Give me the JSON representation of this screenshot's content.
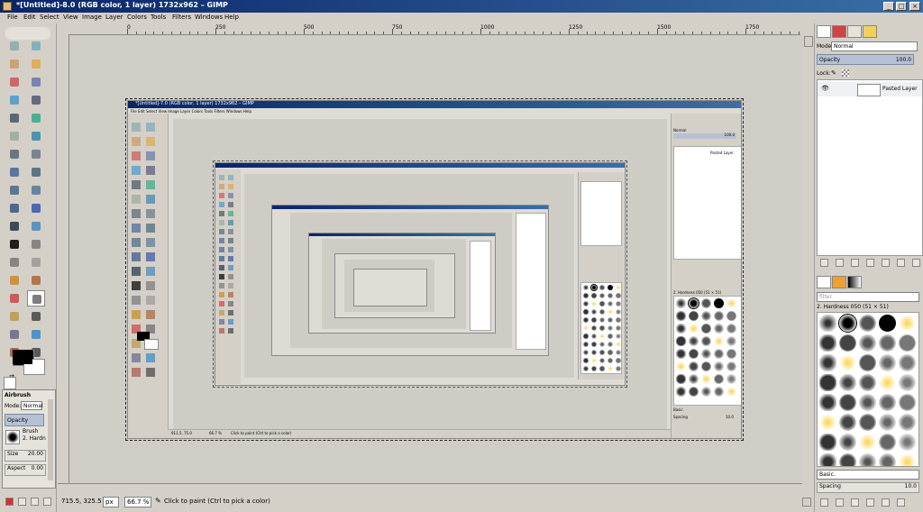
{
  "window": {
    "title": "*[Untitled]-8.0 (RGB color, 1 layer) 1732x962 – GIMP",
    "controls": [
      "_",
      "□",
      "×"
    ]
  },
  "menu": [
    "File",
    "Edit",
    "Select",
    "View",
    "Image",
    "Layer",
    "Colors",
    "Tools",
    "Filters",
    "Windows",
    "Help"
  ],
  "ruler": {
    "labels": [
      "0",
      "250",
      "500",
      "750",
      "1000",
      "1250",
      "1500",
      "1750"
    ]
  },
  "tool_options": {
    "title": "Airbrush",
    "mode_label": "Mode:",
    "mode_value": "Normal",
    "opacity_label": "Opacity",
    "brush_label": "Brush",
    "brush_value": "2. Hardn",
    "size_label": "Size",
    "size_value": "20.00",
    "aspect_label": "Aspect",
    "aspect_value": "0.00"
  },
  "status": {
    "coords": "715.5, 325.5",
    "unit": "px",
    "zoom": "66.7 %",
    "message": "Click to paint (Ctrl to pick a color)"
  },
  "layers": {
    "mode_label": "Mode:",
    "mode_value": "Normal",
    "opacity_label": "Opacity",
    "opacity_value": "100.0",
    "lock_label": "Lock:",
    "layer_name": "Pasted Layer"
  },
  "brushes": {
    "filter_placeholder": "filter",
    "current": "2. Hardness 050 (51 × 51)",
    "preset": "Basic.",
    "spacing_label": "Spacing",
    "spacing_value": "10.0"
  },
  "nested": {
    "title1": "*[Untitled]-7.0 (RGB color, 1 layer) 1732x962 – GIMP",
    "menu1": "File  Edit  Select  View  Image  Layer  Colors  Tools  Filters  Windows  Help",
    "layer1": "Pasted Layer",
    "brush1": "2. Hardness 050 (51 × 51)",
    "mode1": "Normal",
    "opacity1": "100.0",
    "coords1": "911.5, 75.0",
    "zoom1": "66.7 %",
    "msg1": "Click to paint (Ctrl to pick a color)",
    "preset1": "Basic.",
    "spacing1": "Spacing",
    "spacing_val1": "10.0"
  },
  "colors": {
    "titlebar": "#0a246a",
    "titlebar_end": "#3a6ea5",
    "chrome": "#d4d0c8",
    "canvas": "#d0cdc7"
  }
}
